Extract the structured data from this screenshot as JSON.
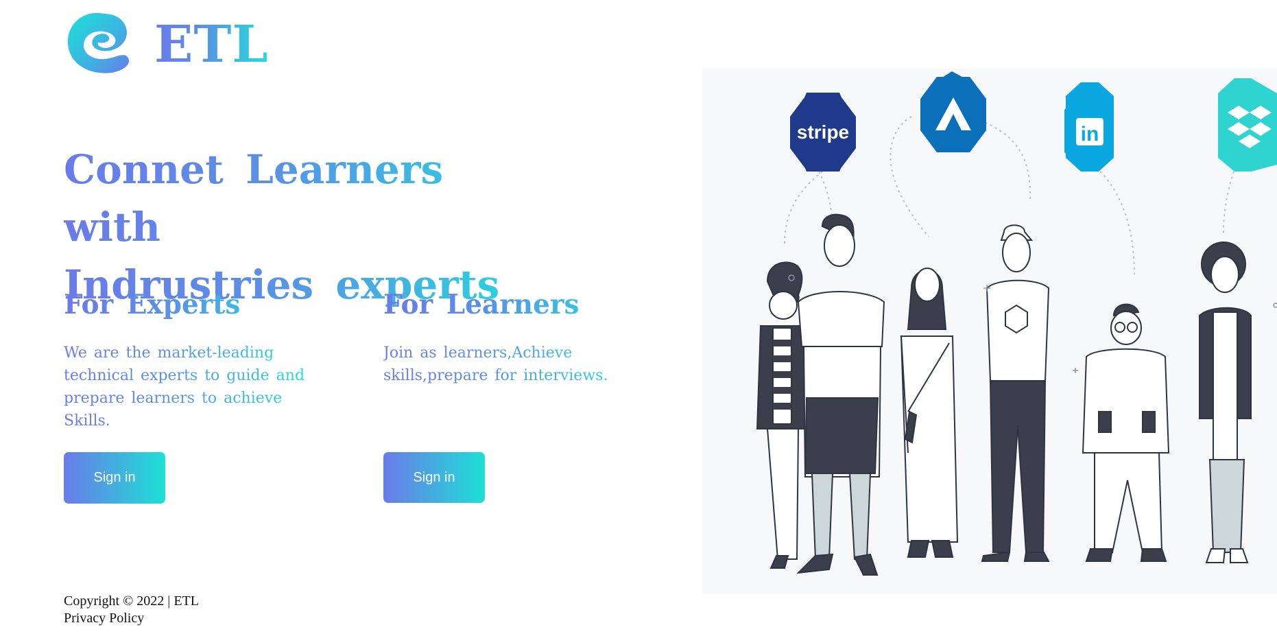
{
  "brand": {
    "logo_icon": "etl-swirl-logo",
    "name": "ETL"
  },
  "hero": {
    "title_line1": "Connet Learners with",
    "title_line2": "Indrustries experts"
  },
  "experts": {
    "heading": "For Experts",
    "description": "We are the market-leading technical experts to guide and prepare learners to achieve Skills.",
    "button_label": "Sign in"
  },
  "learners": {
    "heading": "For Learners",
    "description": "Join as learners,Achieve skills,prepare for interviews.",
    "button_label": "Sign in"
  },
  "illustration": {
    "badges": [
      {
        "name": "stripe",
        "label": "stripe",
        "color": "#1f3a8a"
      },
      {
        "name": "atlassian",
        "label": "",
        "color": "#0b6fba"
      },
      {
        "name": "linkedin",
        "label": "in",
        "color": "#0aa7e0"
      },
      {
        "name": "dropbox",
        "label": "",
        "color": "#2fd3cf"
      }
    ]
  },
  "footer": {
    "copyright": "Copyright © 2022 | ETL",
    "privacy_label": "Privacy Policy"
  },
  "colors": {
    "gradient_start": "#6a7be9",
    "gradient_end": "#1de0d6"
  }
}
